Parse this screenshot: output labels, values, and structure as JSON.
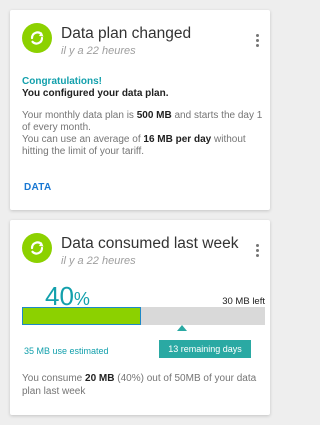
{
  "cards": [
    {
      "icon": "refresh-icon",
      "title": "Data plan changed",
      "time": "il y a 22 heures",
      "congrats": "Congratulations!",
      "configured": "You configured your data plan.",
      "line1_prefix": "Your monthly data plan is ",
      "plan_size": "500 MB",
      "line1_suffix": " and starts the day 1 of every month.",
      "line2_prefix": "You can use an average of ",
      "daily_avg": "16 MB per day",
      "line2_suffix": " without hitting the limit of your tariff.",
      "action": "DATA"
    },
    {
      "icon": "refresh-icon",
      "title": "Data consumed last week",
      "time": "il y a 22 heures",
      "percent_value": "40",
      "percent_sign": "%",
      "mb_left": "30 MB left",
      "usage_fraction": 0.49,
      "marker_fraction": 0.66,
      "used_estimated": "35 MB  use estimated",
      "remaining_days": "13 remaining days",
      "summary_prefix": "You consume ",
      "summary_amount": "20 MB",
      "summary_suffix": " (40%) out of 50MB of your data plan last week"
    }
  ],
  "colors": {
    "accent_green": "#8cd100",
    "teal": "#13a0ac",
    "badge": "#2aa9a3",
    "link_blue": "#1877d2"
  }
}
